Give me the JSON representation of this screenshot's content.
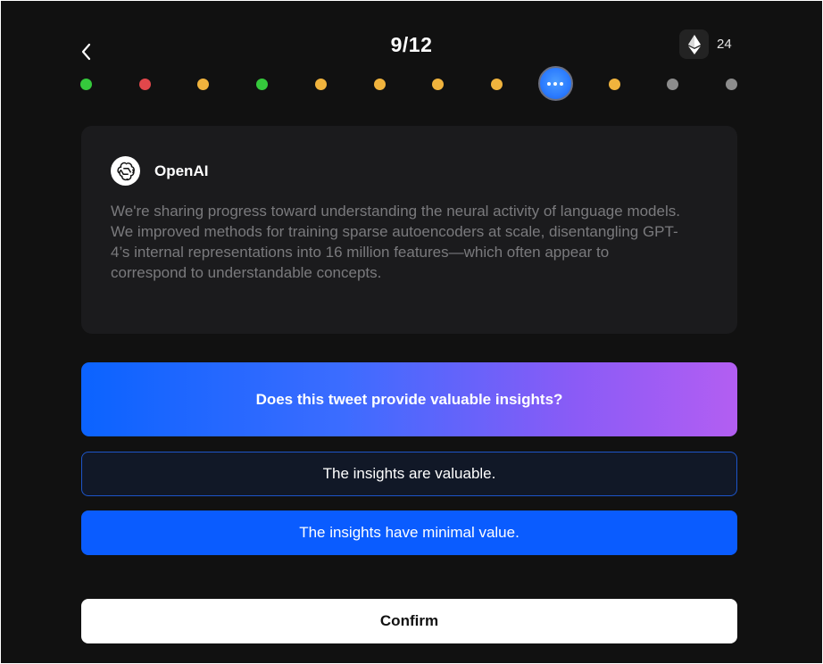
{
  "header": {
    "progress": "9/12",
    "token_count": "24",
    "token_icon": "ethereum-icon",
    "back_icon": "chevron-left-icon"
  },
  "progress_dots": [
    {
      "status": "correct",
      "color": "#35c93c"
    },
    {
      "status": "wrong",
      "color": "#e2474b"
    },
    {
      "status": "answered",
      "color": "#f0b33d"
    },
    {
      "status": "correct",
      "color": "#35c93c"
    },
    {
      "status": "answered",
      "color": "#f0b33d"
    },
    {
      "status": "answered",
      "color": "#f0b33d"
    },
    {
      "status": "answered",
      "color": "#f0b33d"
    },
    {
      "status": "answered",
      "color": "#f0b33d"
    },
    {
      "status": "current",
      "color": "#2b7bff"
    },
    {
      "status": "answered",
      "color": "#f0b33d"
    },
    {
      "status": "pending",
      "color": "#8c8c8c"
    },
    {
      "status": "pending",
      "color": "#8c8c8c"
    }
  ],
  "tweet": {
    "author": "OpenAI",
    "avatar_icon": "openai-logo-icon",
    "text": "We're sharing progress toward understanding the neural activity of language models. We improved methods for training sparse autoencoders at scale, disentangling GPT-4’s internal representations into 16 million features—which often appear to correspond to understandable concepts."
  },
  "question": "Does this tweet provide valuable insights?",
  "options": [
    {
      "label": "The insights are valuable.",
      "selected": false
    },
    {
      "label": "The insights have minimal value.",
      "selected": true
    }
  ],
  "confirm_label": "Confirm",
  "colors": {
    "background": "#111111",
    "card": "#1b1b1d",
    "accent": "#0a5cff",
    "gradient_start": "#0b63ff",
    "gradient_end": "#b35ef2"
  }
}
